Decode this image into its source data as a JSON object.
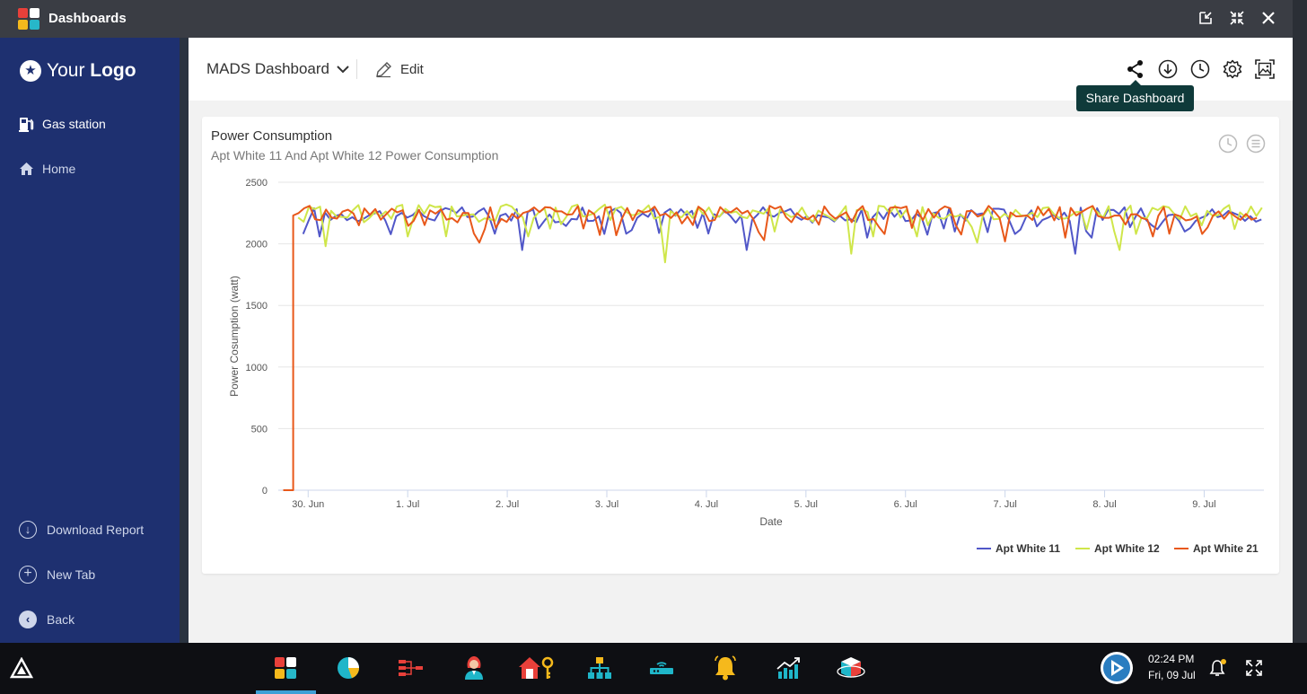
{
  "window": {
    "title": "Dashboards",
    "icons": [
      "restore-icon",
      "collapse-icon",
      "close-icon"
    ]
  },
  "sidebar": {
    "logo_plain": "Your",
    "logo_bold": "Logo",
    "items": [
      {
        "label": "Gas station",
        "icon": "gas-pump-icon"
      },
      {
        "label": "Home",
        "icon": "home-icon"
      }
    ],
    "bottom_items": [
      {
        "label": "Download Report",
        "icon": "download-icon"
      },
      {
        "label": "New Tab",
        "icon": "plus-circle-icon"
      },
      {
        "label": "Back",
        "icon": "back-icon"
      }
    ]
  },
  "topbar": {
    "dashboard_name": "MADS Dashboard",
    "edit_label": "Edit",
    "tools": [
      "share-icon",
      "download-icon",
      "history-icon",
      "settings-icon",
      "screenshot-icon"
    ],
    "tooltip": "Share Dashboard"
  },
  "card": {
    "title": "Power Consumption",
    "subtitle": "Apt White 11 And Apt White 12 Power Consumption"
  },
  "colors": {
    "sidebar": "#1e3070",
    "series_1": "#5157c8",
    "series_2": "#cfe64a",
    "series_3": "#e8581a",
    "tooltip_bg": "#0f3a3a"
  },
  "chart_data": {
    "type": "line",
    "xlabel": "Date",
    "ylabel": "Power Cosumption (watt)",
    "ylim": [
      0,
      2500
    ],
    "yticks": [
      0,
      500,
      1000,
      1500,
      2000,
      2500
    ],
    "xticks": [
      "30. Jun",
      "1. Jul",
      "2. Jul",
      "3. Jul",
      "4. Jul",
      "5. Jul",
      "6. Jul",
      "7. Jul",
      "8. Jul",
      "9. Jul"
    ],
    "x_range_days": [
      -0.3,
      9.6
    ],
    "grid": true,
    "legend": "bottom-right",
    "series": [
      {
        "name": "Apt White 11",
        "color": "#5157c8",
        "start": -0.05,
        "typical": 2240,
        "lows": [
          [
            -0.1,
            2150
          ],
          [
            -0.05,
            2080
          ],
          [
            0.1,
            2060
          ],
          [
            2.15,
            1950
          ],
          [
            3.0,
            2080
          ],
          [
            3.9,
            2130
          ],
          [
            4.4,
            1950
          ],
          [
            4.4,
            1950
          ],
          [
            5.6,
            2050
          ],
          [
            6.5,
            2100
          ],
          [
            7.1,
            2080
          ],
          [
            7.7,
            1920
          ],
          [
            7.85,
            2050
          ],
          [
            8.5,
            2150
          ],
          [
            8.8,
            2100
          ],
          [
            9.5,
            2180
          ]
        ]
      },
      {
        "name": "Apt White 12",
        "color": "#cfe64a",
        "start": -0.1,
        "typical": 2260,
        "lows": [
          [
            -0.05,
            2180
          ],
          [
            0.15,
            1980
          ],
          [
            1.0,
            2060
          ],
          [
            3.6,
            1850
          ],
          [
            2.2,
            2060
          ],
          [
            4.7,
            2100
          ],
          [
            5.45,
            1920
          ],
          [
            5.65,
            2060
          ],
          [
            6.1,
            2060
          ],
          [
            6.7,
            2010
          ],
          [
            8.15,
            1950
          ],
          [
            8.3,
            2080
          ],
          [
            9.0,
            2150
          ],
          [
            9.3,
            2120
          ]
        ]
      },
      {
        "name": "Apt White 21",
        "color": "#e8581a",
        "start": -0.15,
        "typical": 2250,
        "lows": [
          [
            0.5,
            2150
          ],
          [
            1.7,
            2010
          ],
          [
            3.1,
            2070
          ],
          [
            4.6,
            2030
          ],
          [
            5.8,
            2080
          ],
          [
            7.0,
            2020
          ],
          [
            7.6,
            2050
          ],
          [
            8.5,
            2060
          ],
          [
            9.0,
            2080
          ]
        ]
      }
    ]
  },
  "taskbar": {
    "apps": [
      "dashboards-icon",
      "pie-chart-icon",
      "flow-icon",
      "user-icon",
      "home-key-icon",
      "hierarchy-icon",
      "router-icon",
      "bell-icon",
      "trend-chart-icon",
      "cube-icon"
    ],
    "time": "02:24 PM",
    "date": "Fri, 09 Jul"
  }
}
